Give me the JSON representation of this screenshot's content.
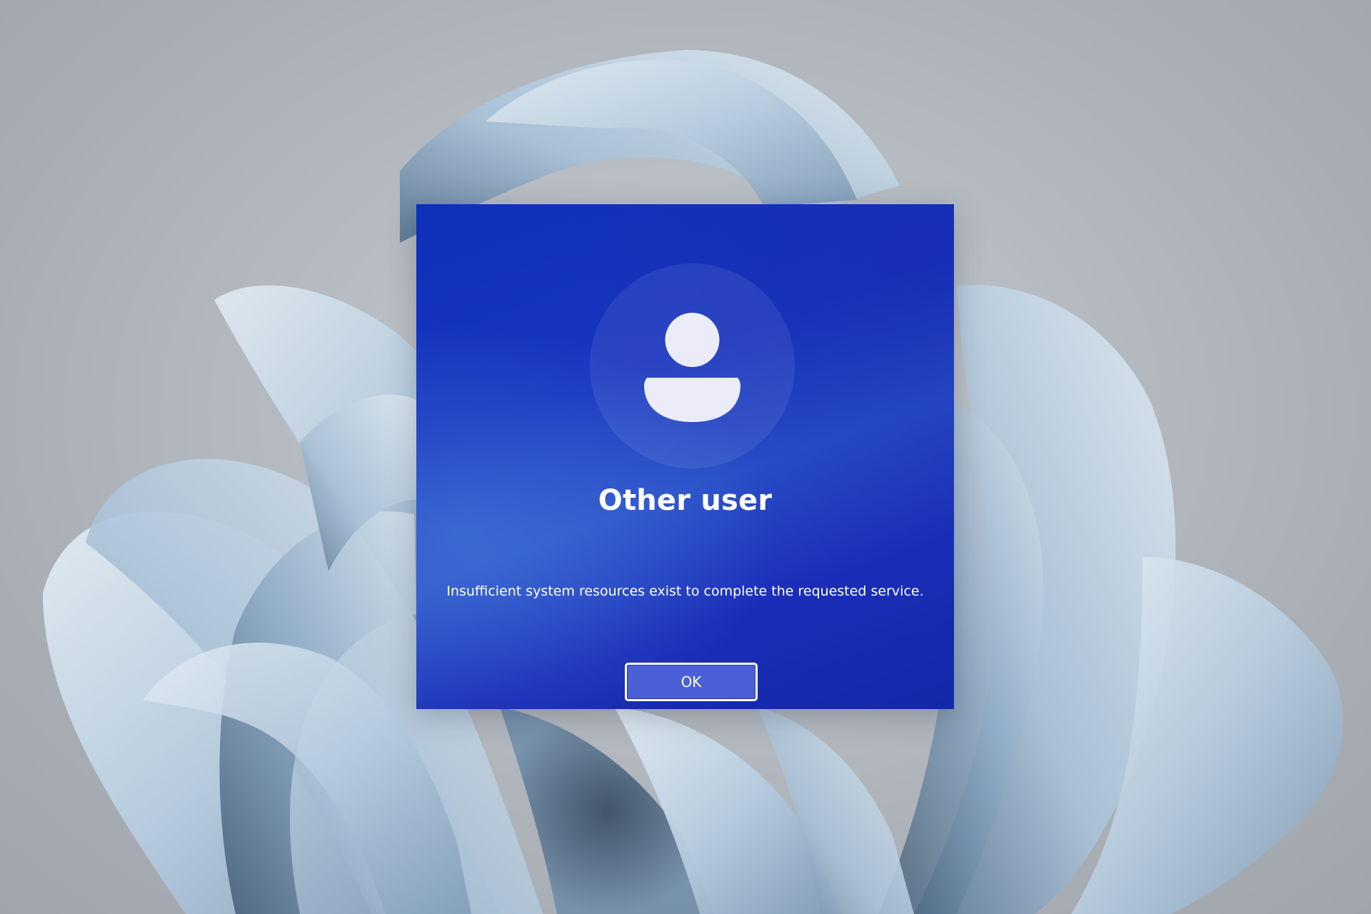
{
  "colors": {
    "background": "#b6bbc1",
    "bloom_light": "#dbe6ef",
    "bloom_mid": "#a9c0d6",
    "bloom_dark": "#4d6680",
    "dialog_background": "#1a35c0",
    "button_fill": "#4b5fd6",
    "text": "#ffffff"
  },
  "wallpaper": {
    "icon": "windows-bloom-wallpaper"
  },
  "dialog": {
    "avatar_icon": "user-icon",
    "title": "Other user",
    "message": "Insufficient system resources exist to complete the requested service.",
    "ok_label": "OK"
  }
}
